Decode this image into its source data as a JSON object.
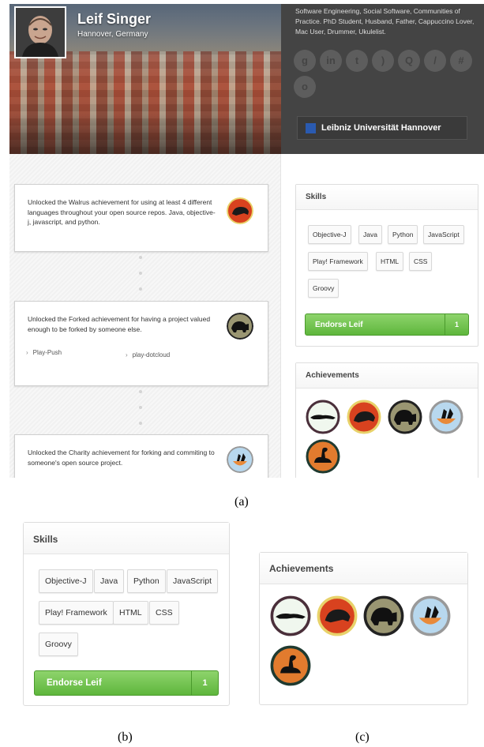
{
  "profile": {
    "name": "Leif Singer",
    "location": "Hannover, Germany",
    "bio": "Software Engineering, Social Software, Communities of Practice. PhD Student, Husband, Father, Cappuccino Lover, Mac User, Drummer, Ukulelist.",
    "university": "Leibniz Universität Hannover",
    "social_icons": [
      {
        "icon": "google-plus-icon",
        "glyph": "g"
      },
      {
        "icon": "linkedin-icon",
        "glyph": "in"
      },
      {
        "icon": "twitter-icon",
        "glyph": "t"
      },
      {
        "icon": "rss-icon",
        "glyph": ")"
      },
      {
        "icon": "lightbulb-icon",
        "glyph": "Q"
      },
      {
        "icon": "pen-icon",
        "glyph": "/"
      },
      {
        "icon": "gift-icon",
        "glyph": "#"
      },
      {
        "icon": "video-icon",
        "glyph": "o"
      }
    ]
  },
  "feed": {
    "items": [
      {
        "text": "Unlocked the Walrus achievement for using at least 4 different languages throughout your open source repos. Java, objective-j, javascript, and python.",
        "badge": "walrus-badge-icon"
      },
      {
        "text": "Unlocked the Forked achievement for having a project valued enough to be forked by someone else.",
        "badge": "forked-badge-icon",
        "repos": [
          "Play-Push",
          "play-dotcloud"
        ]
      },
      {
        "text": "Unlocked the Charity achievement for forking and commiting to someone's open source project.",
        "badge": "charity-badge-icon"
      }
    ]
  },
  "skills": {
    "title": "Skills",
    "tags": [
      "Objective-J",
      "Java",
      "Python",
      "JavaScript",
      "Play! Framework",
      "HTML",
      "CSS",
      "Groovy"
    ],
    "endorse_label": "Endorse Leif",
    "endorse_count": "1"
  },
  "achievements": {
    "title": "Achievements",
    "badges": [
      "lizard-badge-icon",
      "walrus-badge-icon",
      "mammoth-badge-icon",
      "penguin-badge-icon",
      "goose-badge-icon"
    ]
  },
  "captions": {
    "a": "(a)",
    "b": "(b)",
    "c": "(c)"
  },
  "colors": {
    "endorse_green": "#5eb63c",
    "walrus_bg": "#d8421f",
    "mammoth_bg": "#9a9672",
    "penguin_bg": "#b8d8ee",
    "goose_bg": "#e27b2e",
    "lizard_bg": "#f0f7ee"
  }
}
